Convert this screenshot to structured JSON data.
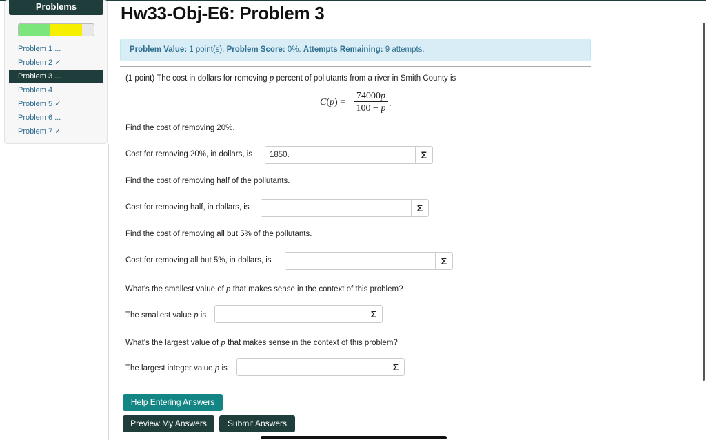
{
  "sidebar": {
    "header": "Problems",
    "items": [
      {
        "label": "Problem 1 ..."
      },
      {
        "label": "Problem 2 ✓"
      },
      {
        "label": "Problem 3 ..."
      },
      {
        "label": "Problem 4"
      },
      {
        "label": "Problem 5 ✓"
      },
      {
        "label": "Problem 6 ..."
      },
      {
        "label": "Problem 7 ✓"
      }
    ],
    "active_item": "Problem 3 ...",
    "progress": {
      "correct_fraction": 0.43,
      "in_progress_fraction": 0.43
    }
  },
  "page": {
    "title": "Hw33-Obj-E6: Problem 3"
  },
  "info": {
    "value_label": "Problem Value:",
    "value_text": "1 point(s).",
    "score_label": "Problem Score:",
    "score_text": "0%.",
    "attempts_label": "Attempts Remaining:",
    "attempts_text": "9 attempts."
  },
  "problem": {
    "intro_a": "(1 point) The cost in dollars for removing",
    "intro_var": "p",
    "intro_b": "percent of pollutants from a river in Smith County is",
    "formula_lhs": "C(p) =",
    "formula_num": "74000p",
    "formula_den": "100 − p",
    "formula_end": ".",
    "q1_prompt": "Find the cost of removing 20%.",
    "q1_label": "Cost for removing 20%, in dollars, is",
    "q1_value": "1850.",
    "q2_prompt": "Find the cost of removing half of the pollutants.",
    "q2_label": "Cost for removing half, in dollars, is",
    "q2_value": "",
    "q3_prompt": "Find the cost of removing all but 5% of the pollutants.",
    "q3_label": "Cost for removing all but 5%, in dollars, is",
    "q3_value": "",
    "q4_prompt_a": "What's the smallest value of",
    "q4_prompt_var": "p",
    "q4_prompt_b": "that makes sense in the context of this problem?",
    "q4_label_a": "The smallest value",
    "q4_label_var": "p",
    "q4_label_b": "is",
    "q4_value": "",
    "q5_prompt_a": "What's the largest value of",
    "q5_prompt_var": "p",
    "q5_prompt_b": "that makes sense in the context of this problem?",
    "q5_label_a": "The largest integer value",
    "q5_label_var": "p",
    "q5_label_b": "is",
    "q5_value": "",
    "sigma": "Σ"
  },
  "buttons": {
    "help": "Help Entering Answers",
    "preview": "Preview My Answers",
    "submit": "Submit Answers"
  },
  "colors": {
    "header_dark": "#1f3d3a",
    "teal": "#138584",
    "info_bg": "#d9edf7",
    "info_text": "#31708f"
  }
}
